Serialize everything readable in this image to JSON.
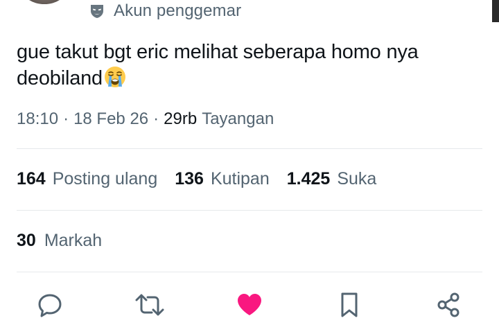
{
  "account": {
    "fan_label": "Akun penggemar"
  },
  "tweet": {
    "text": "gue takut bgt eric melihat seberapa homo nya deobiland",
    "emoji": "loudly-crying-face-emoji"
  },
  "meta": {
    "time": "18:10",
    "separator": "·",
    "date": "18 Feb 26",
    "views_count": "29rb",
    "views_label": "Tayangan"
  },
  "stats": {
    "reposts_count": "164",
    "reposts_label": "Posting ulang",
    "quotes_count": "136",
    "quotes_label": "Kutipan",
    "likes_count": "1.425",
    "likes_label": "Suka",
    "bookmarks_count": "30",
    "bookmarks_label": "Markah"
  },
  "actions": {
    "reply_icon": "reply-icon",
    "repost_icon": "repost-icon",
    "like_icon": "heart-icon",
    "bookmark_icon": "bookmark-icon",
    "share_icon": "share-icon"
  },
  "colors": {
    "text_primary": "#0f1419",
    "text_secondary": "#536471",
    "like_active": "#f91880",
    "divider": "#e6e9eb"
  }
}
